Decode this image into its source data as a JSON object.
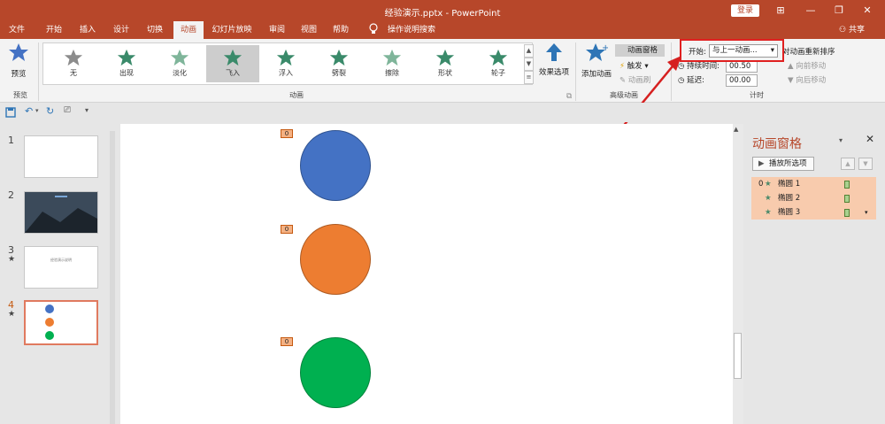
{
  "window": {
    "title": "经验演示.pptx - PowerPoint",
    "login_label": "登录",
    "controls": [
      "⊞",
      "—",
      "❐",
      "✕"
    ]
  },
  "tabs": [
    "文件",
    "开始",
    "插入",
    "设计",
    "切换",
    "动画",
    "幻灯片放映",
    "审阅",
    "视图",
    "帮助"
  ],
  "active_tab": "动画",
  "search_label": "操作说明搜索",
  "share_label": "共享",
  "ribbon": {
    "preview_label": "预览",
    "preview_group": "预览",
    "animations": [
      "无",
      "出现",
      "淡化",
      "飞入",
      "浮入",
      "劈裂",
      "擦除",
      "形状",
      "轮子"
    ],
    "selected_animation": "飞入",
    "animation_group": "动画",
    "effect_options": "效果选项",
    "add_animation": "添加动画",
    "animation_pane_btn": "动画窗格",
    "trigger": "触发",
    "painter": "动画刷",
    "advanced_group": "高级动画",
    "start_label": "开始:",
    "start_value": "与上一动画...",
    "reorder_label": "对动画重新排序",
    "duration_label": "持续时间:",
    "duration_value": "00.50",
    "delay_label": "延迟:",
    "delay_value": "00.00",
    "move_earlier": "向前移动",
    "move_later": "向后移动",
    "timing_group": "计时"
  },
  "thumbnails": [
    {
      "num": "1",
      "star": ""
    },
    {
      "num": "2",
      "star": ""
    },
    {
      "num": "3",
      "star": "★"
    },
    {
      "num": "4",
      "star": "★"
    }
  ],
  "thumb3_text": "经验演示说明",
  "slide": {
    "tags": [
      "0",
      "0",
      "0"
    ],
    "circles": [
      {
        "color": "#4472c4",
        "border": "#2f528f"
      },
      {
        "color": "#ed7d31",
        "border": "#ae5a21"
      },
      {
        "color": "#00b050",
        "border": "#00833b"
      }
    ]
  },
  "pane": {
    "title": "动画窗格",
    "play_label": "播放所选项",
    "items": [
      {
        "index": "0",
        "name": "椭圆 1"
      },
      {
        "index": "",
        "name": "椭圆 2"
      },
      {
        "index": "",
        "name": "椭圆 3"
      }
    ]
  },
  "colors": {
    "accent": "#b7472a",
    "highlight": "#e02020",
    "pane_row": "#f8cbad"
  }
}
